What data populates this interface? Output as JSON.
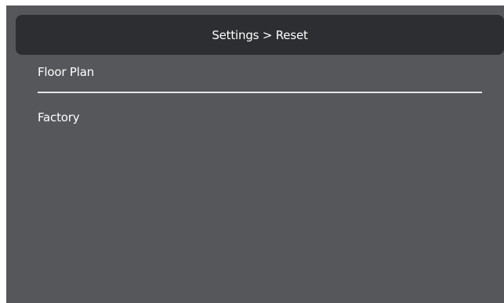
{
  "header": {
    "title": "Settings > Reset"
  },
  "menu": {
    "items": [
      {
        "label": "Floor Plan"
      },
      {
        "label": "Factory"
      }
    ]
  },
  "colors": {
    "background": "#55575b",
    "title_bar": "#2c2e31",
    "text": "#ffffff",
    "divider": "#e6e6e6"
  }
}
